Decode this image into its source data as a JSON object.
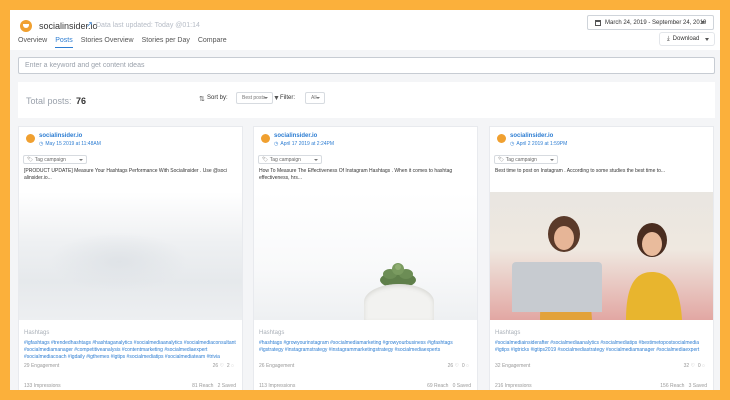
{
  "header": {
    "brand": "socialinsider.io",
    "updated": "Data last updated: Today @01:14",
    "date_range": "March 24, 2019 - September 24, 2019",
    "download_label": "Download",
    "tabs": [
      {
        "label": "Overview",
        "active": false
      },
      {
        "label": "Posts",
        "active": true
      },
      {
        "label": "Stories Overview",
        "active": false
      },
      {
        "label": "Stories per Day",
        "active": false
      },
      {
        "label": "Compare",
        "active": false
      }
    ]
  },
  "search": {
    "placeholder": "Enter a keyword and get content ideas",
    "value": ""
  },
  "summary": {
    "total_label": "Total posts:",
    "total_count": "76",
    "sort_label": "Sort by:",
    "sort_value": "Best posts",
    "filter_label": "Filter:",
    "filter_value": "All"
  },
  "colors": {
    "accent": "#2d7dd2",
    "brand_orange": "#fbb03b"
  },
  "cards": [
    {
      "handle": "socialinsider.io",
      "date": "May 15 2019 at 11:48AM",
      "tag_placeholder": "Tag campaign",
      "caption": "[PRODUCT UPDATE] Measure Your Hashtags Performance With Socialinsider . Use @soci alinsider.io...",
      "hashtags_title": "Hashtags",
      "hashtags": "#igfashtags #trendedhashtags #hashtaganalytics #socialmediaanalytics #socialmediaconsultant #socialmediamanager #competitiveanalysis #contentmarketing #socialmediaexpert #socialmediacoach #igdaily #igthemes #igtips #socialmediatips #socialmediateam #trivia",
      "engagement": "29 Engagement",
      "likes": "26",
      "comments": "2",
      "impressions": "133 Impressions",
      "reach": "81 Reach",
      "saved": "2 Saved"
    },
    {
      "handle": "socialinsider.io",
      "date": "April 17 2019 at 2:24PM",
      "tag_placeholder": "Tag campaign",
      "caption": "How To Measure The Effectiveness Of Instagram Hashtags . When it comes to hashtag effectiveness, hrs...",
      "hashtags_title": "Hashtags",
      "hashtags": "#hashtags #growyourinstagram #socialmediamarketing #growyourbusiness #igfashtags #igstrategy #instagramstrategy #instagrammarketingstrategy #socialmediaexperts",
      "engagement": "26 Engagement",
      "likes": "26",
      "comments": "0",
      "impressions": "113 Impressions",
      "reach": "69 Reach",
      "saved": "0 Saved"
    },
    {
      "handle": "socialinsider.io",
      "date": "April 2 2019 at 1:59PM",
      "tag_placeholder": "Tag campaign",
      "caption": "Best time to post on Instagram . According to some studies the best time to...",
      "hashtags_title": "Hashtags",
      "hashtags": "#socialmediainsiderafter #socialmediaanalytics #socialmediatips #bestimetopostsocialmedia #igtips #igtricks #igtips2019 #socialmediastrategy #socialmediamanager #socialmediaexpert",
      "engagement": "32 Engagement",
      "likes": "32",
      "comments": "0",
      "impressions": "216 Impressions",
      "reach": "156 Reach",
      "saved": "3 Saved"
    }
  ]
}
